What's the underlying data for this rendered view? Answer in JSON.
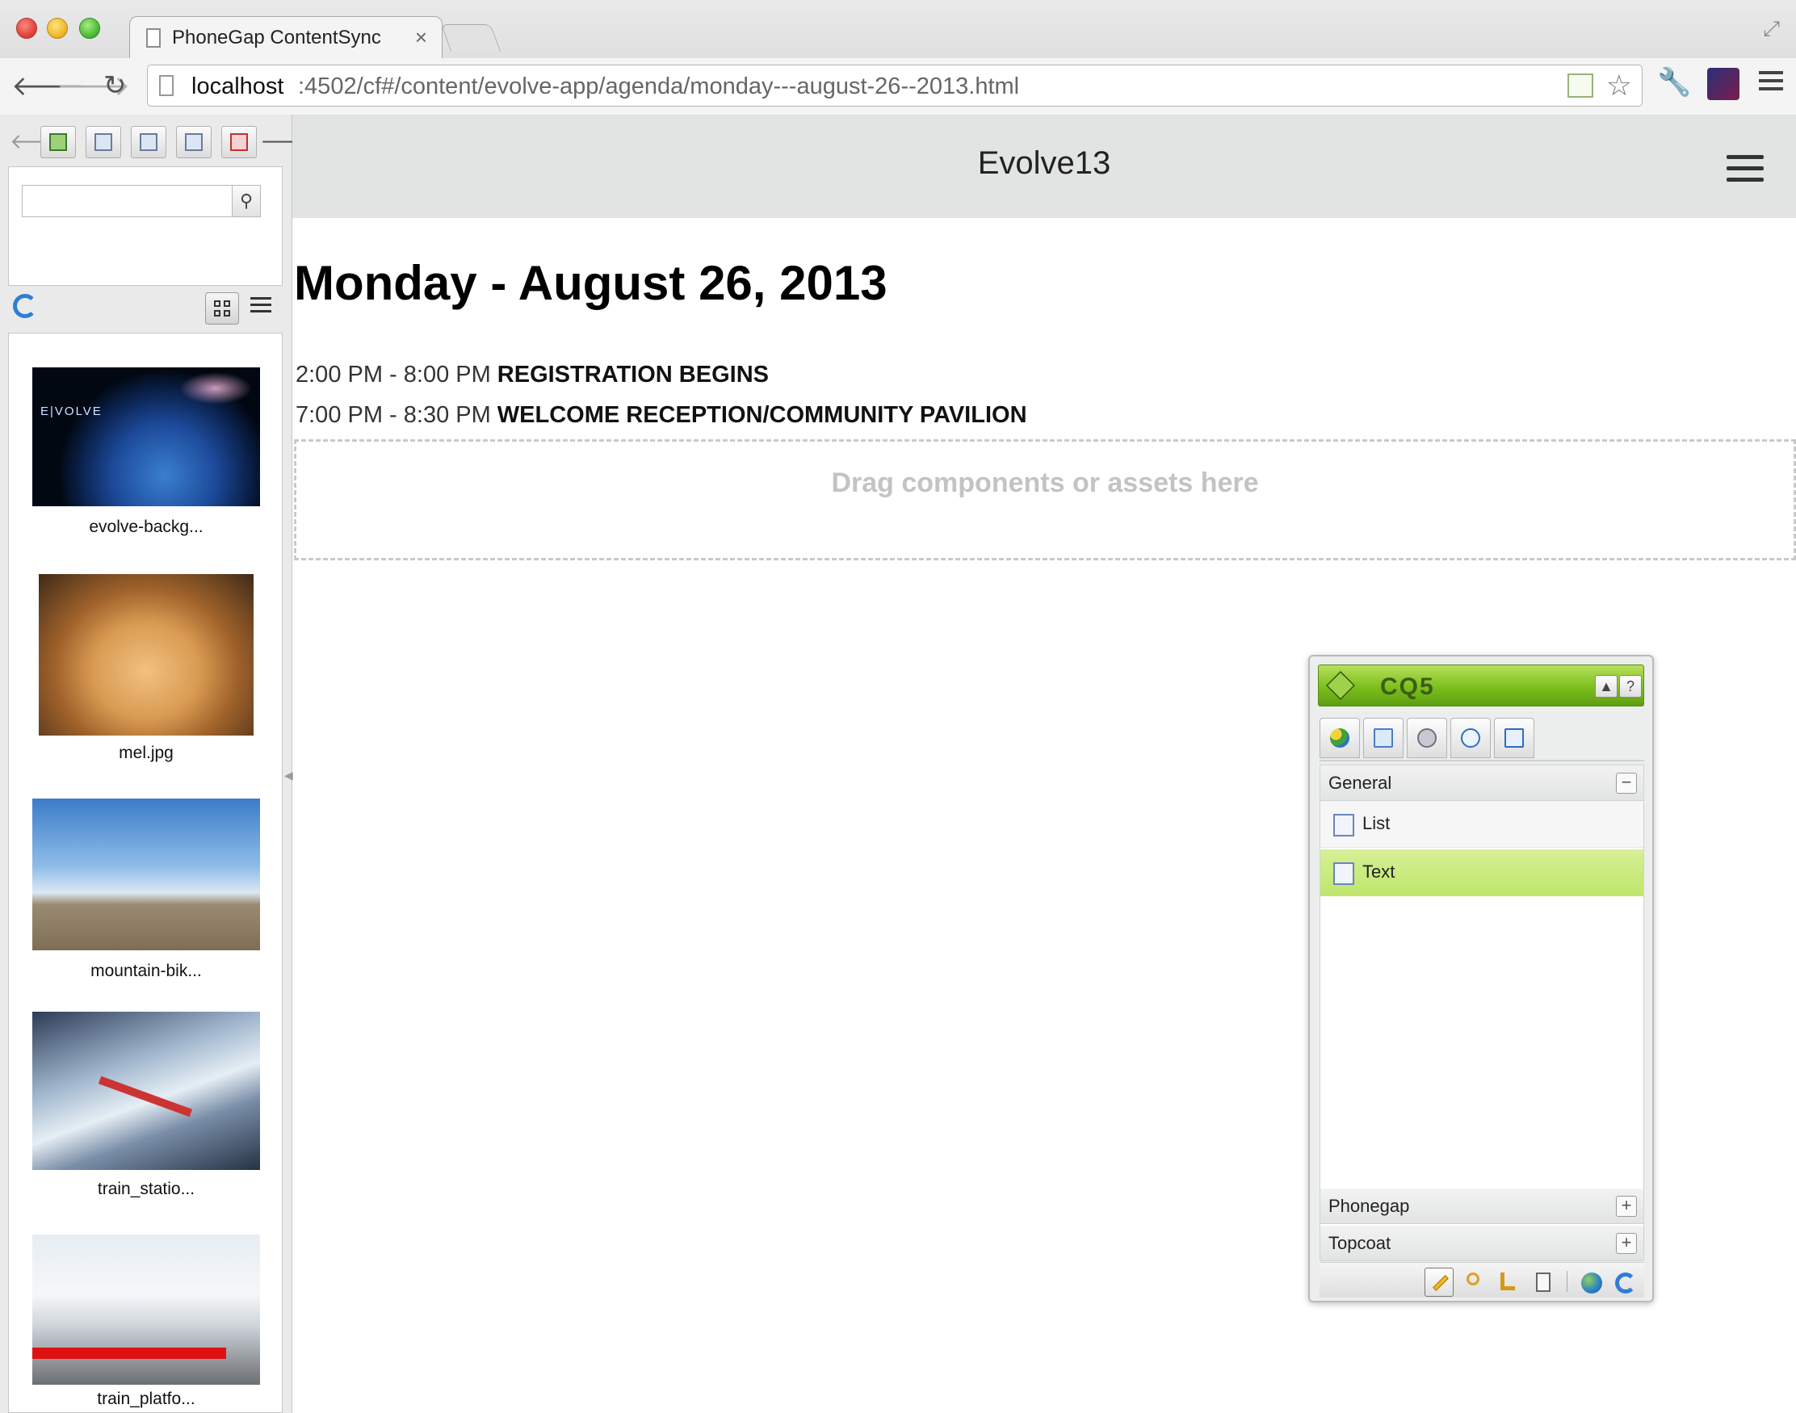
{
  "browser": {
    "tab_title": "PhoneGap ContentSync",
    "tab_close": "×",
    "url_host": "localhost",
    "url_path": ":4502/cf#/content/evolve-app/agenda/monday---august-26--2013.html",
    "icons": {
      "back": "arrow-left-icon",
      "forward": "arrow-right-icon",
      "reload": "reload-icon",
      "bookmark": "star-icon",
      "rss": "rss-icon",
      "wrench": "wrench-icon",
      "extension": "extension-icon",
      "menu": "hamburger-menu-icon"
    }
  },
  "side_panel": {
    "tabs": [
      "images",
      "documents",
      "pages",
      "movies",
      "s7"
    ],
    "search": {
      "value": "",
      "placeholder": ""
    },
    "view_mode": "thumbnails",
    "assets": [
      {
        "name": "evolve-backg...",
        "thumb_text": "E|VOLVE"
      },
      {
        "name": "mel.jpg"
      },
      {
        "name": "mountain-bik..."
      },
      {
        "name": "train_statio..."
      },
      {
        "name": "train_platfo..."
      }
    ]
  },
  "app": {
    "header_title": "Evolve13",
    "page_heading": "Monday - August 26, 2013",
    "agenda": [
      {
        "time": "2:00 PM - 8:00 PM",
        "event": "REGISTRATION BEGINS"
      },
      {
        "time": "7:00 PM - 8:30 PM",
        "event": "WELCOME RECEPTION/COMMUNITY PAVILION"
      }
    ],
    "dropzone_text": "Drag components or assets here"
  },
  "sidekick": {
    "title": "CQ5",
    "collapse_symbol": "▲",
    "help_symbol": "?",
    "tabs": [
      "components",
      "page",
      "lock",
      "versions",
      "workflow"
    ],
    "groups": {
      "general": {
        "label": "General",
        "toggle": "−"
      },
      "phonegap": {
        "label": "Phonegap",
        "toggle": "+"
      },
      "topcoat": {
        "label": "Topcoat",
        "toggle": "+"
      }
    },
    "components": [
      {
        "label": "List",
        "selected": false
      },
      {
        "label": "Text",
        "selected": true
      }
    ],
    "footer_buttons": [
      "edit",
      "preview",
      "design",
      "scaffolding",
      "publish",
      "refresh"
    ],
    "accent_color": "#7cbf1c"
  }
}
